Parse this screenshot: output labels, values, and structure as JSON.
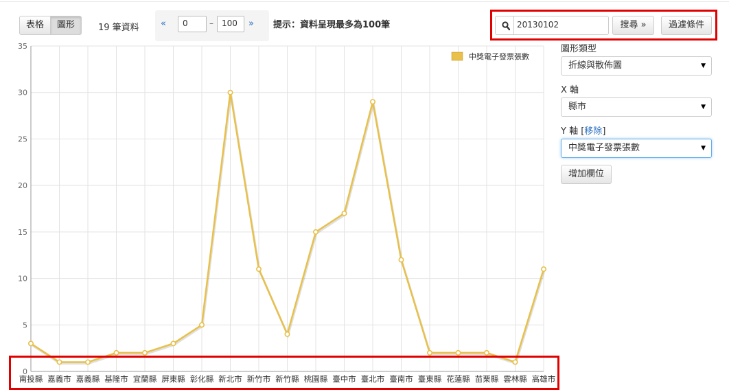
{
  "toolbar": {
    "view_tabs": [
      "表格",
      "圖形"
    ],
    "active_view": "圖形",
    "record_count": "19 筆資料",
    "pager": {
      "prev": "«",
      "from": "0",
      "separator": "–",
      "to": "100",
      "next": "»"
    },
    "hint": "提示：資料呈現最多為100筆"
  },
  "search": {
    "icon": "search-icon",
    "value": "20130102",
    "button_label": "搜尋 »",
    "filter_label": "過濾條件"
  },
  "sidebar": {
    "chart_type_label": "圖形類型",
    "chart_type_value": "折線與散佈圖",
    "x_axis_label": "X 軸",
    "x_axis_value": "縣市",
    "y_axis_label": "Y 軸",
    "y_axis_remove": "移除",
    "y_axis_value": "中獎電子發票張數",
    "add_field_label": "增加欄位"
  },
  "colors": {
    "series": "#e8c04a",
    "highlight": "#e00000",
    "link": "#2a6fc2"
  },
  "chart_data": {
    "type": "line",
    "categories": [
      "南投縣",
      "嘉義市",
      "嘉義縣",
      "基隆市",
      "宜蘭縣",
      "屏東縣",
      "彰化縣",
      "新北市",
      "新竹市",
      "新竹縣",
      "桃園縣",
      "臺中市",
      "臺北市",
      "臺南市",
      "臺東縣",
      "花蓮縣",
      "苗栗縣",
      "雲林縣",
      "高雄市"
    ],
    "series": [
      {
        "name": "中獎電子發票張數",
        "values": [
          3,
          1,
          1,
          2,
          2,
          3,
          5,
          30,
          11,
          4,
          15,
          17,
          29,
          12,
          2,
          2,
          2,
          1,
          11
        ]
      }
    ],
    "ylim": [
      0,
      35
    ],
    "yticks": [
      0,
      5,
      10,
      15,
      20,
      25,
      30,
      35
    ],
    "grid": true,
    "legend": "top-right"
  }
}
